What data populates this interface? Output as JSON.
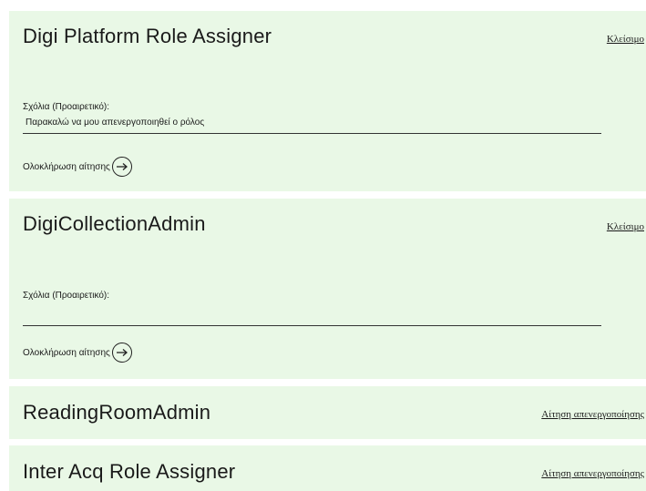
{
  "panels": [
    {
      "title": "Digi Platform Role Assigner",
      "link": "Κλείσιμο",
      "comments_label": "Σχόλια (Προαιρετικό):",
      "comments_value": "Παρακαλώ να μου απενεργοποιηθεί ο ρόλος",
      "submit_label": "Ολοκλήρωση αίτησης"
    },
    {
      "title": "DigiCollectionAdmin",
      "link": "Κλείσιμο",
      "comments_label": "Σχόλια (Προαιρετικό):",
      "comments_value": "",
      "submit_label": "Ολοκλήρωση αίτησης"
    },
    {
      "title": "ReadingRoomAdmin",
      "link": "Αίτηση απενεργοποίησης"
    },
    {
      "title": "Inter Acq Role Assigner",
      "link": "Αίτηση απενεργοποίησης"
    }
  ],
  "icons": {
    "submit": "arrow-right-circle-icon"
  },
  "colors": {
    "panel_background": "#e9f8e6",
    "text": "#1a1a1a",
    "page_background": "#ffffff"
  }
}
